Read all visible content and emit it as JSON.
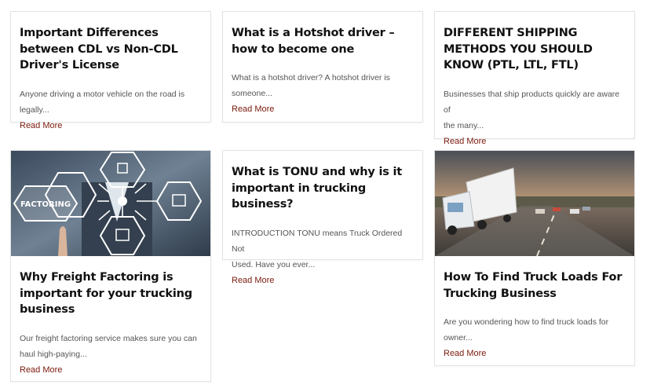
{
  "posts": [
    {
      "title": "Important Differences between CDL vs Non-CDL Driver's License",
      "excerpt_line1": "Anyone driving a motor vehicle on the road is",
      "excerpt_line2": "legally...",
      "read_more": "Read More"
    },
    {
      "title": "What is a Hotshot driver – how to become one",
      "excerpt_line1": "What is a hotshot driver? A hotshot driver is",
      "excerpt_line2": "someone...",
      "read_more": "Read More"
    },
    {
      "title": "DIFFERENT SHIPPING METHODS YOU SHOULD KNOW (PTL, LTL, FTL)",
      "excerpt_line1": "Businesses that ship products quickly are aware of",
      "excerpt_line2": "the many...",
      "read_more": "Read More"
    },
    {
      "title": "Why Freight Factoring is important for your trucking business",
      "excerpt_line1": "Our freight factoring service makes sure you can",
      "excerpt_line2": "haul high-paying...",
      "read_more": "Read More",
      "image_label": "FACTORING"
    },
    {
      "title": "What is TONU and why is it important in trucking business?",
      "excerpt_line1": "INTRODUCTION TONU means Truck Ordered Not",
      "excerpt_line2": "Used. Have you ever...",
      "read_more": "Read More"
    },
    {
      "title": "How To Find Truck Loads For Trucking Business",
      "excerpt_line1": " Are you wondering how to find truck loads for",
      "excerpt_line2": "owner...",
      "read_more": "Read More"
    }
  ],
  "colors": {
    "link": "#7a1a0c",
    "title": "#111111",
    "excerpt": "#555555"
  }
}
